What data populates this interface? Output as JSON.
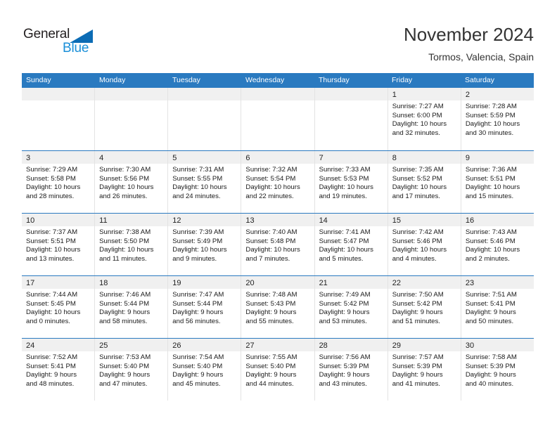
{
  "brand": {
    "name_part1": "General",
    "name_part2": "Blue",
    "accent_color": "#1a8fd8",
    "triangle_color": "#0c6cb5"
  },
  "header": {
    "title": "November 2024",
    "location": "Tormos, Valencia, Spain"
  },
  "calendar": {
    "header_color": "#2a7ac0",
    "weekday_headers": [
      "Sunday",
      "Monday",
      "Tuesday",
      "Wednesday",
      "Thursday",
      "Friday",
      "Saturday"
    ],
    "weeks": [
      [
        {
          "day": "",
          "sunrise": "",
          "sunset": "",
          "daylight_line1": "",
          "daylight_line2": ""
        },
        {
          "day": "",
          "sunrise": "",
          "sunset": "",
          "daylight_line1": "",
          "daylight_line2": ""
        },
        {
          "day": "",
          "sunrise": "",
          "sunset": "",
          "daylight_line1": "",
          "daylight_line2": ""
        },
        {
          "day": "",
          "sunrise": "",
          "sunset": "",
          "daylight_line1": "",
          "daylight_line2": ""
        },
        {
          "day": "",
          "sunrise": "",
          "sunset": "",
          "daylight_line1": "",
          "daylight_line2": ""
        },
        {
          "day": "1",
          "sunrise": "Sunrise: 7:27 AM",
          "sunset": "Sunset: 6:00 PM",
          "daylight_line1": "Daylight: 10 hours",
          "daylight_line2": "and 32 minutes."
        },
        {
          "day": "2",
          "sunrise": "Sunrise: 7:28 AM",
          "sunset": "Sunset: 5:59 PM",
          "daylight_line1": "Daylight: 10 hours",
          "daylight_line2": "and 30 minutes."
        }
      ],
      [
        {
          "day": "3",
          "sunrise": "Sunrise: 7:29 AM",
          "sunset": "Sunset: 5:58 PM",
          "daylight_line1": "Daylight: 10 hours",
          "daylight_line2": "and 28 minutes."
        },
        {
          "day": "4",
          "sunrise": "Sunrise: 7:30 AM",
          "sunset": "Sunset: 5:56 PM",
          "daylight_line1": "Daylight: 10 hours",
          "daylight_line2": "and 26 minutes."
        },
        {
          "day": "5",
          "sunrise": "Sunrise: 7:31 AM",
          "sunset": "Sunset: 5:55 PM",
          "daylight_line1": "Daylight: 10 hours",
          "daylight_line2": "and 24 minutes."
        },
        {
          "day": "6",
          "sunrise": "Sunrise: 7:32 AM",
          "sunset": "Sunset: 5:54 PM",
          "daylight_line1": "Daylight: 10 hours",
          "daylight_line2": "and 22 minutes."
        },
        {
          "day": "7",
          "sunrise": "Sunrise: 7:33 AM",
          "sunset": "Sunset: 5:53 PM",
          "daylight_line1": "Daylight: 10 hours",
          "daylight_line2": "and 19 minutes."
        },
        {
          "day": "8",
          "sunrise": "Sunrise: 7:35 AM",
          "sunset": "Sunset: 5:52 PM",
          "daylight_line1": "Daylight: 10 hours",
          "daylight_line2": "and 17 minutes."
        },
        {
          "day": "9",
          "sunrise": "Sunrise: 7:36 AM",
          "sunset": "Sunset: 5:51 PM",
          "daylight_line1": "Daylight: 10 hours",
          "daylight_line2": "and 15 minutes."
        }
      ],
      [
        {
          "day": "10",
          "sunrise": "Sunrise: 7:37 AM",
          "sunset": "Sunset: 5:51 PM",
          "daylight_line1": "Daylight: 10 hours",
          "daylight_line2": "and 13 minutes."
        },
        {
          "day": "11",
          "sunrise": "Sunrise: 7:38 AM",
          "sunset": "Sunset: 5:50 PM",
          "daylight_line1": "Daylight: 10 hours",
          "daylight_line2": "and 11 minutes."
        },
        {
          "day": "12",
          "sunrise": "Sunrise: 7:39 AM",
          "sunset": "Sunset: 5:49 PM",
          "daylight_line1": "Daylight: 10 hours",
          "daylight_line2": "and 9 minutes."
        },
        {
          "day": "13",
          "sunrise": "Sunrise: 7:40 AM",
          "sunset": "Sunset: 5:48 PM",
          "daylight_line1": "Daylight: 10 hours",
          "daylight_line2": "and 7 minutes."
        },
        {
          "day": "14",
          "sunrise": "Sunrise: 7:41 AM",
          "sunset": "Sunset: 5:47 PM",
          "daylight_line1": "Daylight: 10 hours",
          "daylight_line2": "and 5 minutes."
        },
        {
          "day": "15",
          "sunrise": "Sunrise: 7:42 AM",
          "sunset": "Sunset: 5:46 PM",
          "daylight_line1": "Daylight: 10 hours",
          "daylight_line2": "and 4 minutes."
        },
        {
          "day": "16",
          "sunrise": "Sunrise: 7:43 AM",
          "sunset": "Sunset: 5:46 PM",
          "daylight_line1": "Daylight: 10 hours",
          "daylight_line2": "and 2 minutes."
        }
      ],
      [
        {
          "day": "17",
          "sunrise": "Sunrise: 7:44 AM",
          "sunset": "Sunset: 5:45 PM",
          "daylight_line1": "Daylight: 10 hours",
          "daylight_line2": "and 0 minutes."
        },
        {
          "day": "18",
          "sunrise": "Sunrise: 7:46 AM",
          "sunset": "Sunset: 5:44 PM",
          "daylight_line1": "Daylight: 9 hours",
          "daylight_line2": "and 58 minutes."
        },
        {
          "day": "19",
          "sunrise": "Sunrise: 7:47 AM",
          "sunset": "Sunset: 5:44 PM",
          "daylight_line1": "Daylight: 9 hours",
          "daylight_line2": "and 56 minutes."
        },
        {
          "day": "20",
          "sunrise": "Sunrise: 7:48 AM",
          "sunset": "Sunset: 5:43 PM",
          "daylight_line1": "Daylight: 9 hours",
          "daylight_line2": "and 55 minutes."
        },
        {
          "day": "21",
          "sunrise": "Sunrise: 7:49 AM",
          "sunset": "Sunset: 5:42 PM",
          "daylight_line1": "Daylight: 9 hours",
          "daylight_line2": "and 53 minutes."
        },
        {
          "day": "22",
          "sunrise": "Sunrise: 7:50 AM",
          "sunset": "Sunset: 5:42 PM",
          "daylight_line1": "Daylight: 9 hours",
          "daylight_line2": "and 51 minutes."
        },
        {
          "day": "23",
          "sunrise": "Sunrise: 7:51 AM",
          "sunset": "Sunset: 5:41 PM",
          "daylight_line1": "Daylight: 9 hours",
          "daylight_line2": "and 50 minutes."
        }
      ],
      [
        {
          "day": "24",
          "sunrise": "Sunrise: 7:52 AM",
          "sunset": "Sunset: 5:41 PM",
          "daylight_line1": "Daylight: 9 hours",
          "daylight_line2": "and 48 minutes."
        },
        {
          "day": "25",
          "sunrise": "Sunrise: 7:53 AM",
          "sunset": "Sunset: 5:40 PM",
          "daylight_line1": "Daylight: 9 hours",
          "daylight_line2": "and 47 minutes."
        },
        {
          "day": "26",
          "sunrise": "Sunrise: 7:54 AM",
          "sunset": "Sunset: 5:40 PM",
          "daylight_line1": "Daylight: 9 hours",
          "daylight_line2": "and 45 minutes."
        },
        {
          "day": "27",
          "sunrise": "Sunrise: 7:55 AM",
          "sunset": "Sunset: 5:40 PM",
          "daylight_line1": "Daylight: 9 hours",
          "daylight_line2": "and 44 minutes."
        },
        {
          "day": "28",
          "sunrise": "Sunrise: 7:56 AM",
          "sunset": "Sunset: 5:39 PM",
          "daylight_line1": "Daylight: 9 hours",
          "daylight_line2": "and 43 minutes."
        },
        {
          "day": "29",
          "sunrise": "Sunrise: 7:57 AM",
          "sunset": "Sunset: 5:39 PM",
          "daylight_line1": "Daylight: 9 hours",
          "daylight_line2": "and 41 minutes."
        },
        {
          "day": "30",
          "sunrise": "Sunrise: 7:58 AM",
          "sunset": "Sunset: 5:39 PM",
          "daylight_line1": "Daylight: 9 hours",
          "daylight_line2": "and 40 minutes."
        }
      ]
    ]
  }
}
